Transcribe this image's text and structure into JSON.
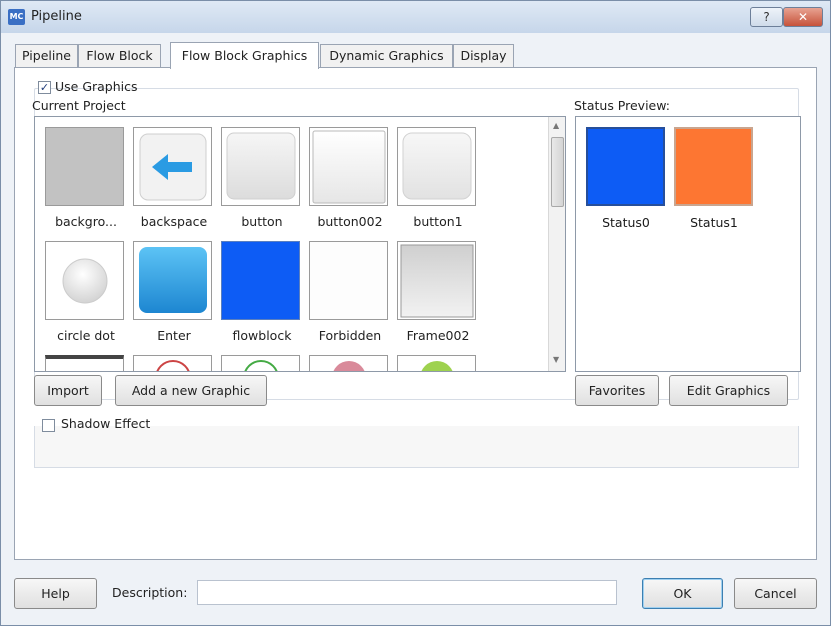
{
  "window": {
    "title": "Pipeline",
    "app_icon_text": "MC",
    "help_glyph": "?",
    "close_glyph": "✕"
  },
  "tabs": [
    {
      "label": "Pipeline",
      "active": false
    },
    {
      "label": "Flow Block",
      "active": false
    },
    {
      "label": "Flow Block Graphics",
      "active": true
    },
    {
      "label": "Dynamic Graphics",
      "active": false
    },
    {
      "label": "Display",
      "active": false
    }
  ],
  "use_graphics": {
    "label": "Use Graphics",
    "checked": true,
    "check_glyph": "✓"
  },
  "current_project": {
    "label": "Current Project",
    "graphics": [
      {
        "name": "backgro...",
        "icon": "gray-square-icon"
      },
      {
        "name": "backspace",
        "icon": "back-arrow-icon"
      },
      {
        "name": "button",
        "icon": "button-graphic-icon"
      },
      {
        "name": "button002",
        "icon": "button-graphic-icon"
      },
      {
        "name": "button1",
        "icon": "button-graphic-icon"
      },
      {
        "name": "circle dot",
        "icon": "circle-dot-icon"
      },
      {
        "name": "Enter",
        "icon": "blue-button-icon"
      },
      {
        "name": "flowblock",
        "icon": "blue-square-icon"
      },
      {
        "name": "Forbidden",
        "icon": "blank-icon"
      },
      {
        "name": "Frame002",
        "icon": "frame-icon"
      }
    ]
  },
  "status_preview": {
    "label": "Status Preview:",
    "items": [
      {
        "name": "Status0",
        "color": "#0d5cf5"
      },
      {
        "name": "Status1",
        "color": "#fd7632"
      }
    ]
  },
  "buttons": {
    "import": "Import",
    "add_graphic": "Add a new Graphic",
    "favorites": "Favorites",
    "edit_graphics": "Edit Graphics",
    "help": "Help",
    "ok": "OK",
    "cancel": "Cancel"
  },
  "shadow_effect": {
    "label": "Shadow Effect",
    "checked": false
  },
  "description": {
    "label": "Description:",
    "value": ""
  },
  "colors": {
    "accent_blue": "#0d5cf5",
    "accent_orange": "#fd7632",
    "window_bg": "#eef2f7"
  }
}
